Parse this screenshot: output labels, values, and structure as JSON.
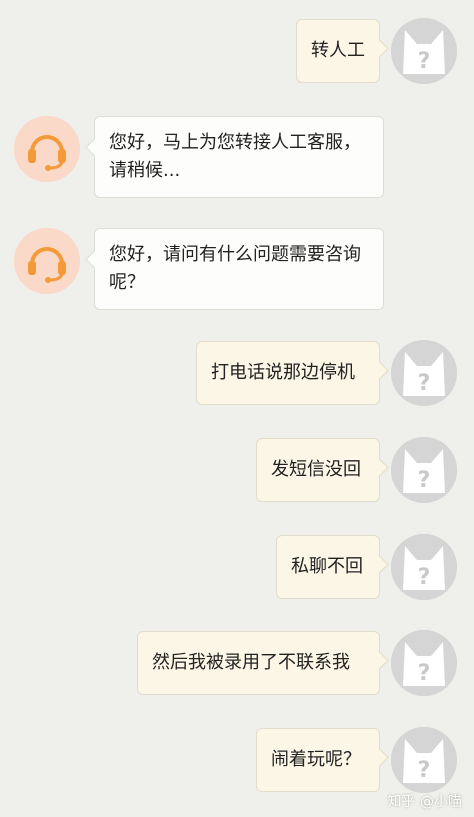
{
  "colors": {
    "background": "#efefeb",
    "user_bubble": "#fbf6e6",
    "agent_bubble": "#fdfdfc",
    "agent_avatar_bg": "#fbd9c8",
    "agent_avatar_icon": "#f39a3b",
    "user_avatar_bg": "#d5d5d5"
  },
  "icons": {
    "agent_avatar": "headset-icon",
    "user_avatar": "placeholder-cat-avatar-icon"
  },
  "messages": [
    {
      "sender": "user",
      "text": "转人工"
    },
    {
      "sender": "agent",
      "text": "您好，马上为您转接人工客服，请稍候..."
    },
    {
      "sender": "agent",
      "text": "您好，请问有什么问题需要咨询呢？"
    },
    {
      "sender": "user",
      "text": "打电话说那边停机"
    },
    {
      "sender": "user",
      "text": "发短信没回"
    },
    {
      "sender": "user",
      "text": "私聊不回"
    },
    {
      "sender": "user",
      "text": "然后我被录用了不联系我"
    },
    {
      "sender": "user",
      "text": "闹着玩呢？"
    }
  ],
  "watermark": "知乎 @小喵"
}
